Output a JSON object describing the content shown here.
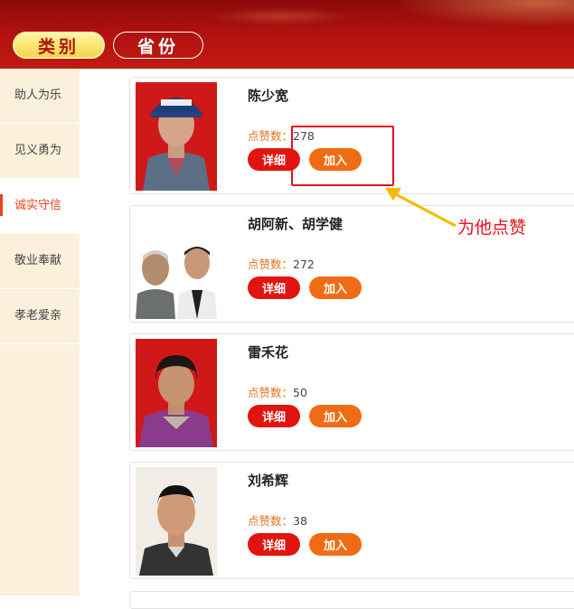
{
  "header": {
    "tabs": [
      {
        "label": "类别",
        "active": true
      },
      {
        "label": "省份",
        "active": false
      }
    ]
  },
  "sidebar": {
    "items": [
      {
        "label": "助人为乐",
        "active": false
      },
      {
        "label": "见义勇为",
        "active": false
      },
      {
        "label": "诚实守信",
        "active": true
      },
      {
        "label": "敬业奉献",
        "active": false
      },
      {
        "label": "孝老爱亲",
        "active": false
      }
    ]
  },
  "cards": [
    {
      "name": "陈少宽",
      "likes_label": "点赞数：",
      "likes": "278",
      "detail_label": "详细",
      "join_label": "加入"
    },
    {
      "name": "胡阿新、胡学健",
      "likes_label": "点赞数：",
      "likes": "272",
      "detail_label": "详细",
      "join_label": "加入"
    },
    {
      "name": "雷禾花",
      "likes_label": "点赞数：",
      "likes": "50",
      "detail_label": "详细",
      "join_label": "加入"
    },
    {
      "name": "刘希辉",
      "likes_label": "点赞数：",
      "likes": "38",
      "detail_label": "详细",
      "join_label": "加入"
    }
  ],
  "annotation": {
    "text": "为他点赞",
    "color": "#e8101a"
  },
  "colors": {
    "header_red": "#b3130f",
    "accent_orange": "#f06c14",
    "detail_red": "#e1140f",
    "sidebar_bg": "#fbf0dc",
    "active_text": "#e8431e",
    "likes_label": "#e0731c"
  }
}
